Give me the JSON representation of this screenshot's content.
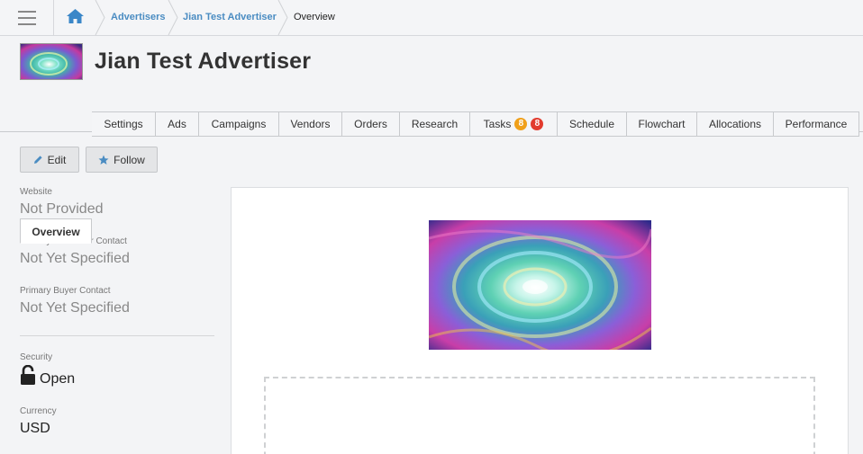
{
  "breadcrumb": {
    "items": [
      "Advertisers",
      "Jian Test Advertiser"
    ],
    "current": "Overview"
  },
  "header": {
    "title": "Jian Test Advertiser"
  },
  "tabs": [
    {
      "label": "Overview",
      "active": true
    },
    {
      "label": "Settings"
    },
    {
      "label": "Ads"
    },
    {
      "label": "Campaigns"
    },
    {
      "label": "Vendors"
    },
    {
      "label": "Orders"
    },
    {
      "label": "Research"
    },
    {
      "label": "Tasks",
      "badges": [
        {
          "value": "8",
          "color": "#f0a01a"
        },
        {
          "value": "8",
          "color": "#e23b2e"
        }
      ]
    },
    {
      "label": "Schedule"
    },
    {
      "label": "Flowchart"
    },
    {
      "label": "Allocations"
    },
    {
      "label": "Performance"
    }
  ],
  "actions": {
    "edit_label": "Edit",
    "follow_label": "Follow"
  },
  "details": {
    "website_label": "Website",
    "website_value": "Not Provided",
    "primary_contact_label": "Primary Advertiser Contact",
    "primary_contact_value": "Not Yet Specified",
    "buyer_contact_label": "Primary Buyer Contact",
    "buyer_contact_value": "Not Yet Specified",
    "security_label": "Security",
    "security_value": "Open",
    "currency_label": "Currency",
    "currency_value": "USD"
  },
  "colors": {
    "link": "#4a8cc2",
    "badge_orange": "#f0a01a",
    "badge_red": "#e23b2e",
    "home_icon": "#3a87c8",
    "star_icon": "#4a8cc2"
  },
  "icons": [
    "menu-icon",
    "home-icon",
    "pencil-icon",
    "star-icon",
    "unlock-icon"
  ]
}
